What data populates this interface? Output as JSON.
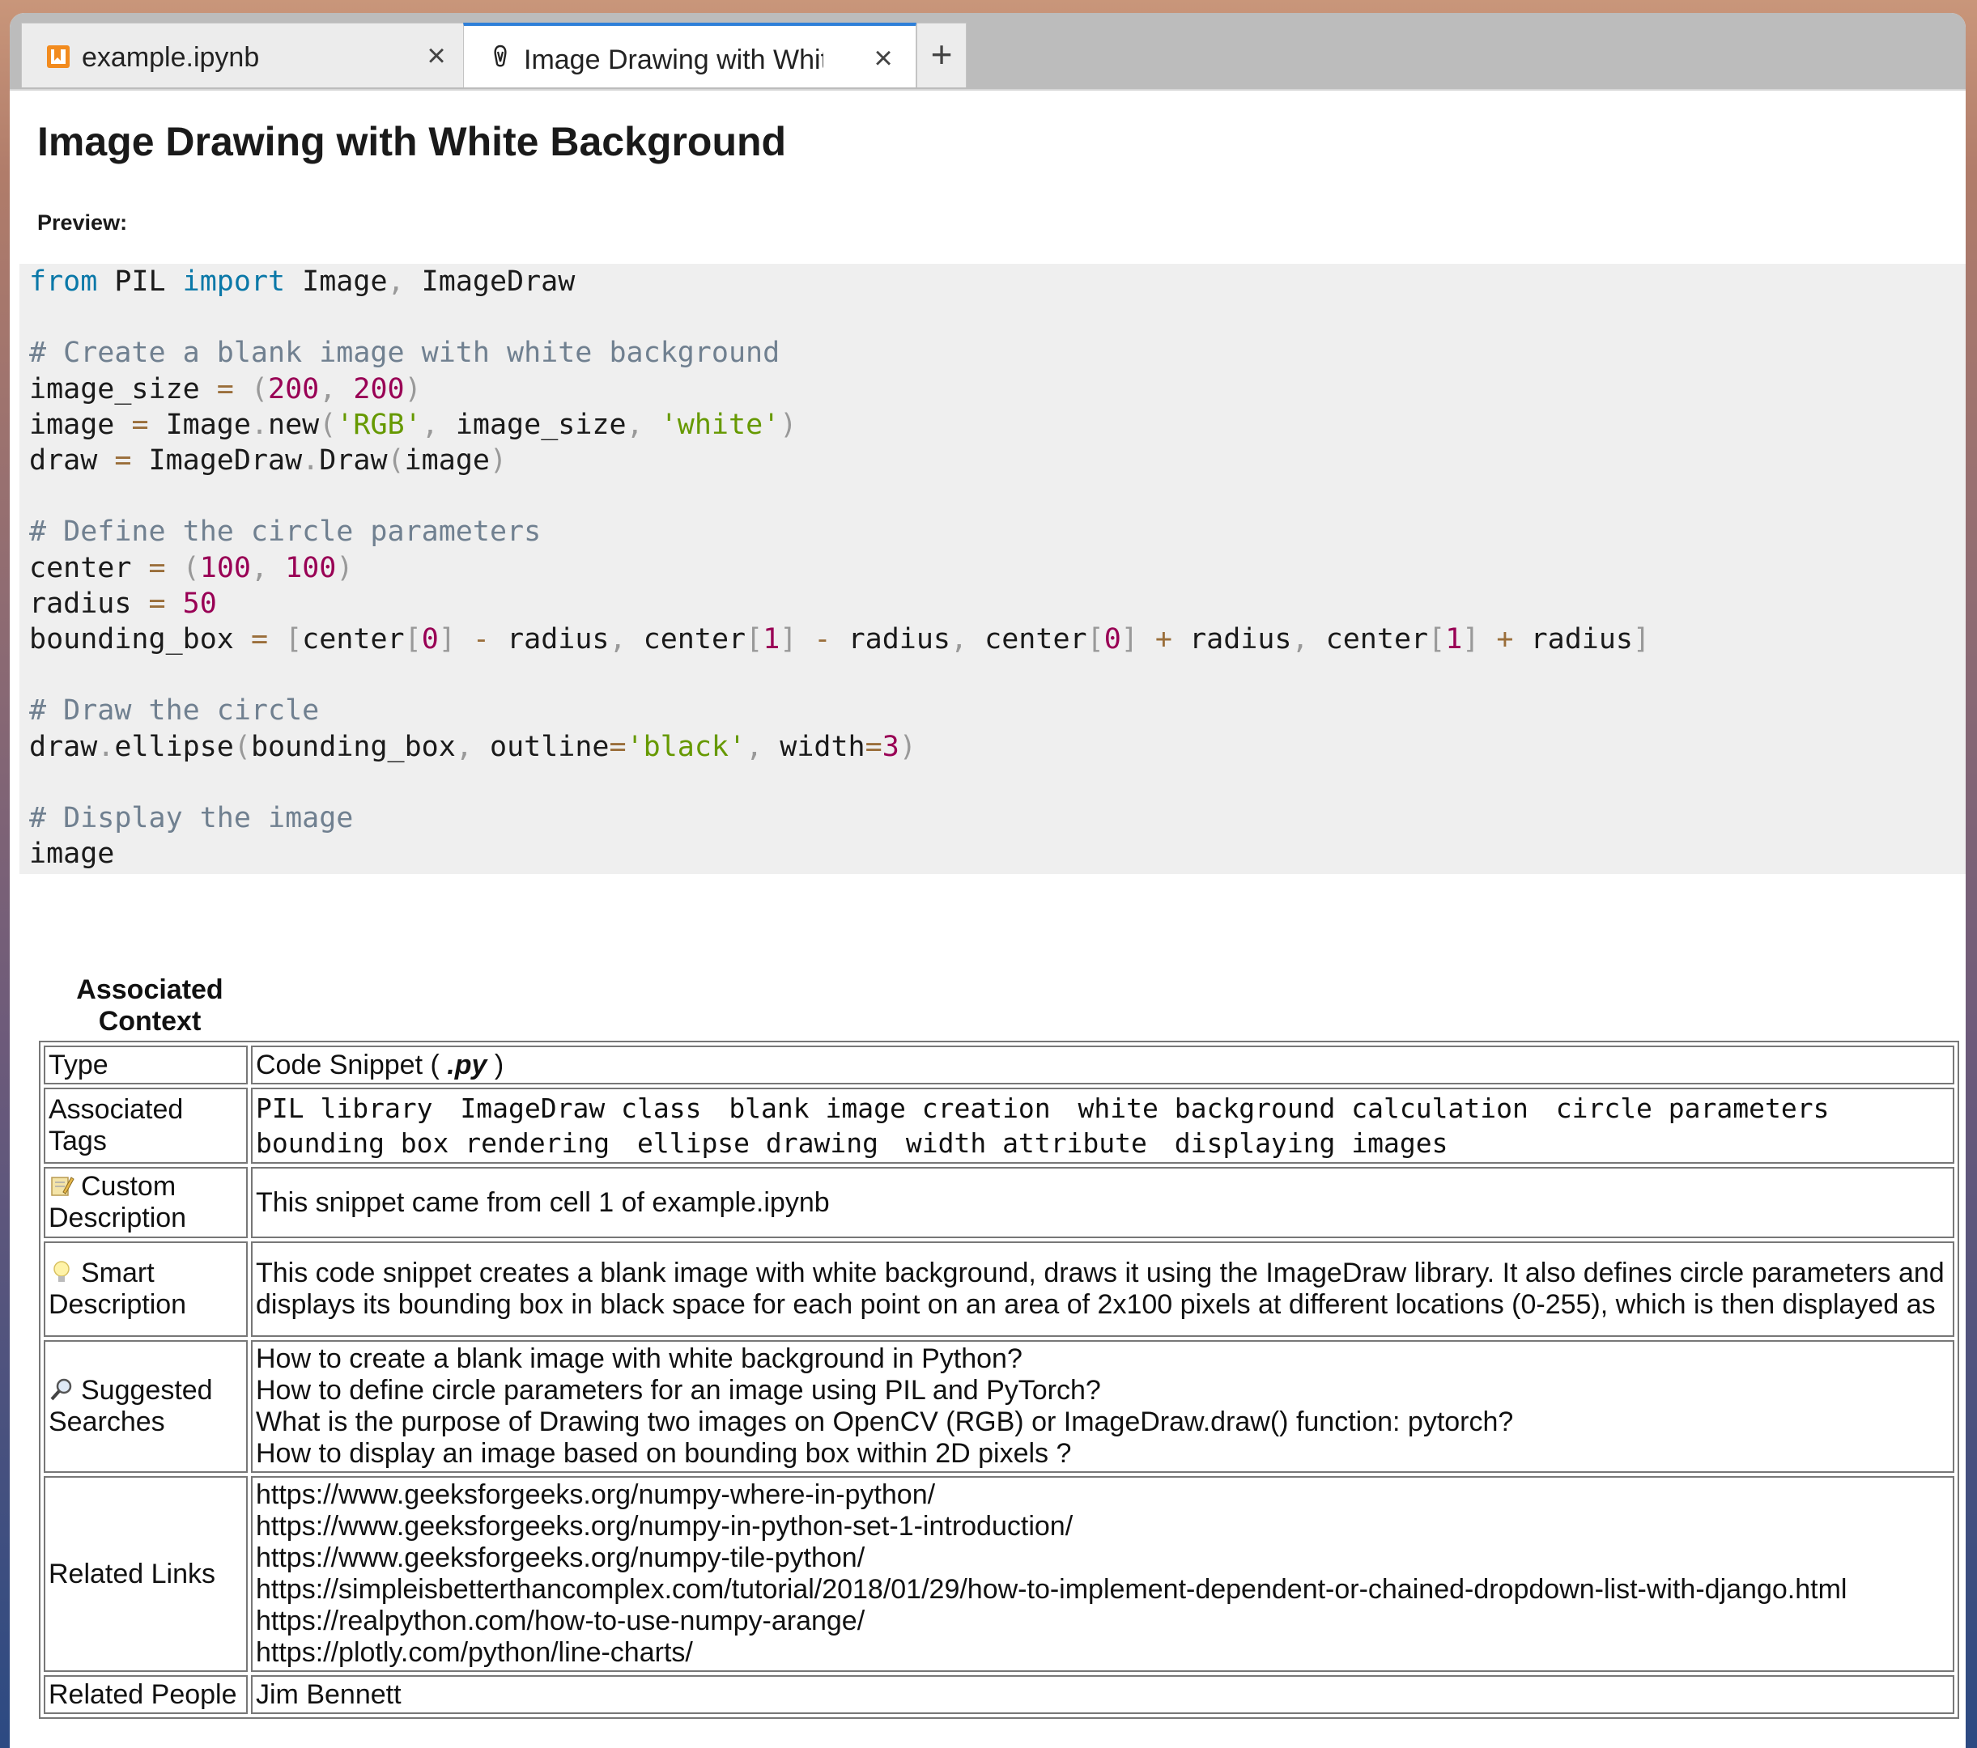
{
  "tabs": [
    {
      "title": "example.ipynb",
      "active": false
    },
    {
      "title": "Image Drawing with White Background",
      "active": true
    }
  ],
  "new_tab_label": "+",
  "close_label": "×",
  "page": {
    "title": "Image Drawing with White Background",
    "preview_label": "Preview:"
  },
  "code_lines": [
    "from PIL import Image, ImageDraw",
    "",
    "# Create a blank image with white background",
    "image_size = (200, 200)",
    "image = Image.new('RGB', image_size, 'white')",
    "draw = ImageDraw.Draw(image)",
    "",
    "# Define the circle parameters",
    "center = (100, 100)",
    "radius = 50",
    "bounding_box = [center[0] - radius, center[1] - radius, center[0] + radius, center[1] + radius]",
    "",
    "# Draw the circle",
    "draw.ellipse(bounding_box, outline='black', width=3)",
    "",
    "# Display the image",
    "image"
  ],
  "context": {
    "title": "Associated Context",
    "type_label": "Type",
    "type_value_prefix": "Code Snippet ( ",
    "type_value_ext": ".py",
    "type_value_suffix": " )",
    "tags_label": "Associated Tags",
    "tags": [
      "PIL library",
      "ImageDraw class",
      "blank image creation",
      "white background calculation",
      "circle parameters",
      "bounding box rendering",
      "ellipse drawing",
      "width attribute",
      "displaying images"
    ],
    "custom_desc_label": "Custom Description",
    "custom_desc": "This snippet came from cell 1 of example.ipynb",
    "smart_desc_label": "Smart Description",
    "smart_desc": "This code snippet creates a blank image with white background, draws it using the ImageDraw library. It also defines circle parameters and displays its bounding box in black space for each point on an area of 2x100 pixels at different locations (0-255), which is then displayed as",
    "searches_label": "Suggested Searches",
    "searches": [
      "How to create a blank image with white background in Python?",
      "How to define circle parameters for an image using PIL and PyTorch?",
      "What is the purpose of Drawing two images on OpenCV (RGB) or ImageDraw.draw() function: pytorch?",
      "How to display an image based on bounding box within 2D pixels ?"
    ],
    "links_label": "Related Links",
    "links": [
      "https://www.geeksforgeeks.org/numpy-where-in-python/",
      "https://www.geeksforgeeks.org/numpy-in-python-set-1-introduction/",
      "https://www.geeksforgeeks.org/numpy-tile-python/",
      "https://simpleisbetterthancomplex.com/tutorial/2018/01/29/how-to-implement-dependent-or-chained-dropdown-list-with-django.html",
      "https://realpython.com/how-to-use-numpy-arange/",
      "https://plotly.com/python/line-charts/"
    ],
    "people_label": "Related People",
    "people": "Jim Bennett"
  },
  "colors": {
    "active_tab_accent": "#2e7fd8",
    "keyword": "#0a78a8",
    "comment": "#708090",
    "number": "#990055",
    "string": "#669900",
    "code_background": "#efefef"
  },
  "icons": [
    "notebook-icon",
    "snippet-icon",
    "close-icon",
    "plus-icon",
    "memo-icon",
    "lightbulb-icon",
    "magnifier-icon"
  ]
}
